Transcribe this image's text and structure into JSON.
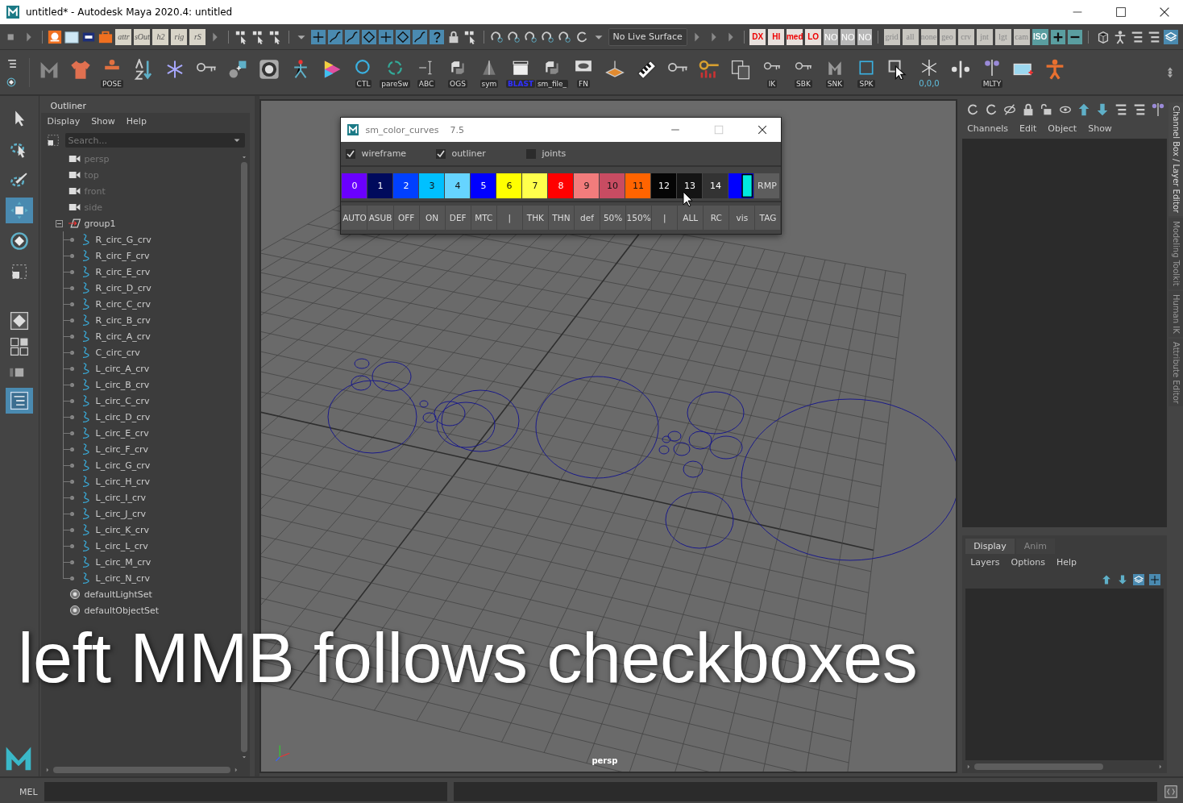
{
  "window": {
    "title": "untitled* - Autodesk Maya 2020.4: untitled"
  },
  "status_line": {
    "live_surface": "No Live Surface",
    "buttons": [
      {
        "label": "attr",
        "kind": "tool"
      },
      {
        "label": "sOut",
        "kind": "tool"
      },
      {
        "label": "h2",
        "kind": "tool"
      },
      {
        "label": "rig",
        "kind": "tool"
      },
      {
        "label": "rS",
        "kind": "tool"
      },
      {
        "label": "DX",
        "kind": "red"
      },
      {
        "label": "HI",
        "kind": "red"
      },
      {
        "label": "med",
        "kind": "red"
      },
      {
        "label": "LO",
        "kind": "red"
      },
      {
        "label": "NO",
        "kind": "no"
      },
      {
        "label": "NO",
        "kind": "no"
      },
      {
        "label": "NO",
        "kind": "no"
      },
      {
        "label": "grid",
        "kind": "mask"
      },
      {
        "label": "all",
        "kind": "mask"
      },
      {
        "label": "none",
        "kind": "mask"
      },
      {
        "label": "geo",
        "kind": "mask"
      },
      {
        "label": "crv",
        "kind": "mask"
      },
      {
        "label": "jnt",
        "kind": "mask"
      },
      {
        "label": "lgt",
        "kind": "mask"
      },
      {
        "label": "cam",
        "kind": "mask"
      },
      {
        "label": "ISO",
        "kind": "iso"
      }
    ]
  },
  "shelf": {
    "labels": [
      "POSE",
      "CTL",
      "pareSw",
      "ABC",
      "OGS",
      "sym",
      "BLAST",
      "sm_file_",
      "FN",
      "IK",
      "SBK",
      "SNK",
      "SPK",
      "0,0,0",
      "MLTY"
    ]
  },
  "toolbox": [
    {
      "selected": false
    },
    {
      "selected": false
    },
    {
      "selected": false
    },
    {
      "selected": true
    },
    {
      "selected": false
    },
    {
      "selected": false
    }
  ],
  "outliner": {
    "tab": "Outliner",
    "menus": [
      "Display",
      "Show",
      "Help"
    ],
    "search": {
      "placeholder": "Search..."
    },
    "items": [
      {
        "kind": "camera",
        "label": "persp"
      },
      {
        "kind": "camera",
        "label": "top"
      },
      {
        "kind": "camera",
        "label": "front"
      },
      {
        "kind": "camera",
        "label": "side"
      },
      {
        "kind": "group",
        "label": "group1",
        "expanded": true,
        "children": [
          {
            "kind": "curve",
            "label": "R_circ_G_crv"
          },
          {
            "kind": "curve",
            "label": "R_circ_F_crv"
          },
          {
            "kind": "curve",
            "label": "R_circ_E_crv"
          },
          {
            "kind": "curve",
            "label": "R_circ_D_crv"
          },
          {
            "kind": "curve",
            "label": "R_circ_C_crv"
          },
          {
            "kind": "curve",
            "label": "R_circ_B_crv"
          },
          {
            "kind": "curve",
            "label": "R_circ_A_crv"
          },
          {
            "kind": "curve",
            "label": "C_circ_crv"
          },
          {
            "kind": "curve",
            "label": "L_circ_A_crv"
          },
          {
            "kind": "curve",
            "label": "L_circ_B_crv"
          },
          {
            "kind": "curve",
            "label": "L_circ_C_crv"
          },
          {
            "kind": "curve",
            "label": "L_circ_D_crv"
          },
          {
            "kind": "curve",
            "label": "L_circ_E_crv"
          },
          {
            "kind": "curve",
            "label": "L_circ_F_crv"
          },
          {
            "kind": "curve",
            "label": "L_circ_G_crv"
          },
          {
            "kind": "curve",
            "label": "L_circ_H_crv"
          },
          {
            "kind": "curve",
            "label": "L_circ_I_crv"
          },
          {
            "kind": "curve",
            "label": "L_circ_J_crv"
          },
          {
            "kind": "curve",
            "label": "L_circ_K_crv"
          },
          {
            "kind": "curve",
            "label": "L_circ_L_crv"
          },
          {
            "kind": "curve",
            "label": "L_circ_M_crv"
          },
          {
            "kind": "curve",
            "label": "L_circ_N_crv"
          }
        ]
      },
      {
        "kind": "set",
        "label": "defaultLightSet"
      },
      {
        "kind": "set",
        "label": "defaultObjectSet"
      }
    ]
  },
  "dialog": {
    "title": "sm_color_curves",
    "version": "7.5",
    "checkboxes": [
      {
        "label": "wireframe",
        "checked": true
      },
      {
        "label": "outliner",
        "checked": true
      },
      {
        "label": "joints",
        "checked": false
      }
    ],
    "swatches": [
      {
        "label": "0",
        "color": "#6a00ff"
      },
      {
        "label": "1",
        "color": "#000a5c"
      },
      {
        "label": "2",
        "color": "#0040ff"
      },
      {
        "label": "3",
        "color": "#00c0ff"
      },
      {
        "label": "4",
        "color": "#66d4ff"
      },
      {
        "label": "5",
        "color": "#0000ff"
      },
      {
        "label": "6",
        "color": "#ffff00"
      },
      {
        "label": "7",
        "color": "#ffff4c"
      },
      {
        "label": "8",
        "color": "#ff0000"
      },
      {
        "label": "9",
        "color": "#f27c7c"
      },
      {
        "label": "10",
        "color": "#c84c62"
      },
      {
        "label": "11",
        "color": "#ff6400"
      },
      {
        "label": "12",
        "color": "#050505"
      },
      {
        "label": "13",
        "color": "#141414"
      },
      {
        "label": "14",
        "color": "#333333"
      }
    ],
    "ramp_button": "RMP",
    "buttons": [
      "AUTO",
      "ASUB",
      "OFF",
      "ON",
      "DEF",
      "MTC",
      "|",
      "THK",
      "THN",
      "def",
      "50%",
      "150%",
      "|",
      "ALL",
      "RC",
      "vis",
      "TAG"
    ]
  },
  "viewport": {
    "camera": "persp",
    "caption": "left MMB follows checkboxes"
  },
  "channel_box": {
    "menus": [
      "Channels",
      "Edit",
      "Object",
      "Show"
    ]
  },
  "layer_editor": {
    "tabs": [
      {
        "label": "Display",
        "selected": true
      },
      {
        "label": "Anim",
        "selected": false
      }
    ],
    "menus": [
      "Layers",
      "Options",
      "Help"
    ]
  },
  "side_tabs": [
    {
      "label": "Channel Box / Layer Editor",
      "selected": true
    },
    {
      "label": "Modeling Toolkit",
      "selected": false
    },
    {
      "label": "Human IK",
      "selected": false
    },
    {
      "label": "Attribute Editor",
      "selected": false
    }
  ],
  "command_line": {
    "label": "MEL"
  }
}
